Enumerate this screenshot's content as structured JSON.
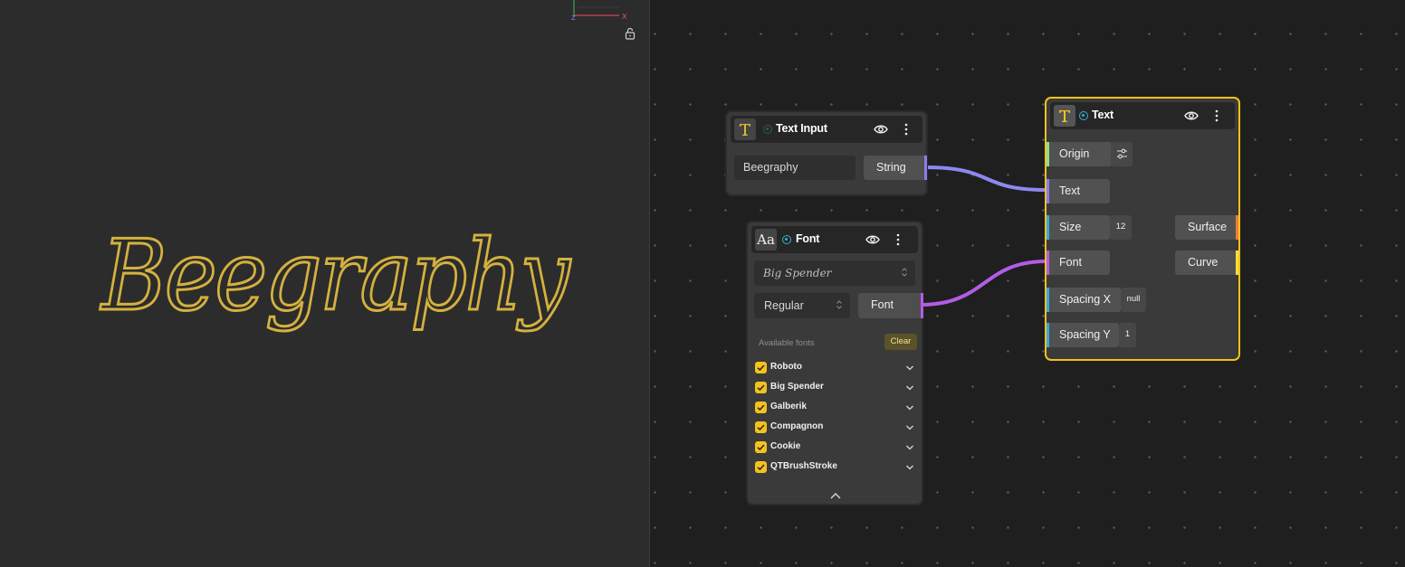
{
  "viewport": {
    "preview_text": "Beegraphy",
    "text_color": "#d4b13f",
    "axes": {
      "z_label": "Z",
      "x_label": "X"
    },
    "icons": [
      "lock-open-icon"
    ]
  },
  "nodes": {
    "text_input": {
      "title": "Text Input",
      "value": "Beegraphy",
      "output_port": "String",
      "icon": "text-t-icon"
    },
    "font": {
      "title": "Font",
      "icon_text": "Aa",
      "selected_font": "Big Spender",
      "style": "Regular",
      "output_port": "Font",
      "available_label": "Available fonts",
      "clear_label": "Clear",
      "fonts": [
        "Roboto",
        "Big Spender",
        "Galberik",
        "Compagnon",
        "Cookie",
        "QTBrushStroke"
      ]
    },
    "text": {
      "title": "Text",
      "icon": "text-t-icon",
      "inputs": [
        {
          "label": "Origin",
          "color": "#8fe08a"
        },
        {
          "label": "Text",
          "color": "#8a7cf0"
        },
        {
          "label": "Size",
          "value": "12",
          "color": "#3aa7e0"
        },
        {
          "label": "Font",
          "color": "#b25de6"
        },
        {
          "label": "Spacing X",
          "value": "null",
          "color": "#3aa7e0"
        },
        {
          "label": "Spacing Y",
          "value": "1",
          "color": "#3aa7e0"
        }
      ],
      "outputs": [
        {
          "label": "Surface",
          "color": "#ee7d3a"
        },
        {
          "label": "Curve",
          "color": "#f2e23a"
        }
      ]
    }
  },
  "colors": {
    "accent": "#f4c21b",
    "wire_string": "#8f87f0",
    "wire_font": "#b25de6",
    "status_active": "#2fb3d8"
  }
}
